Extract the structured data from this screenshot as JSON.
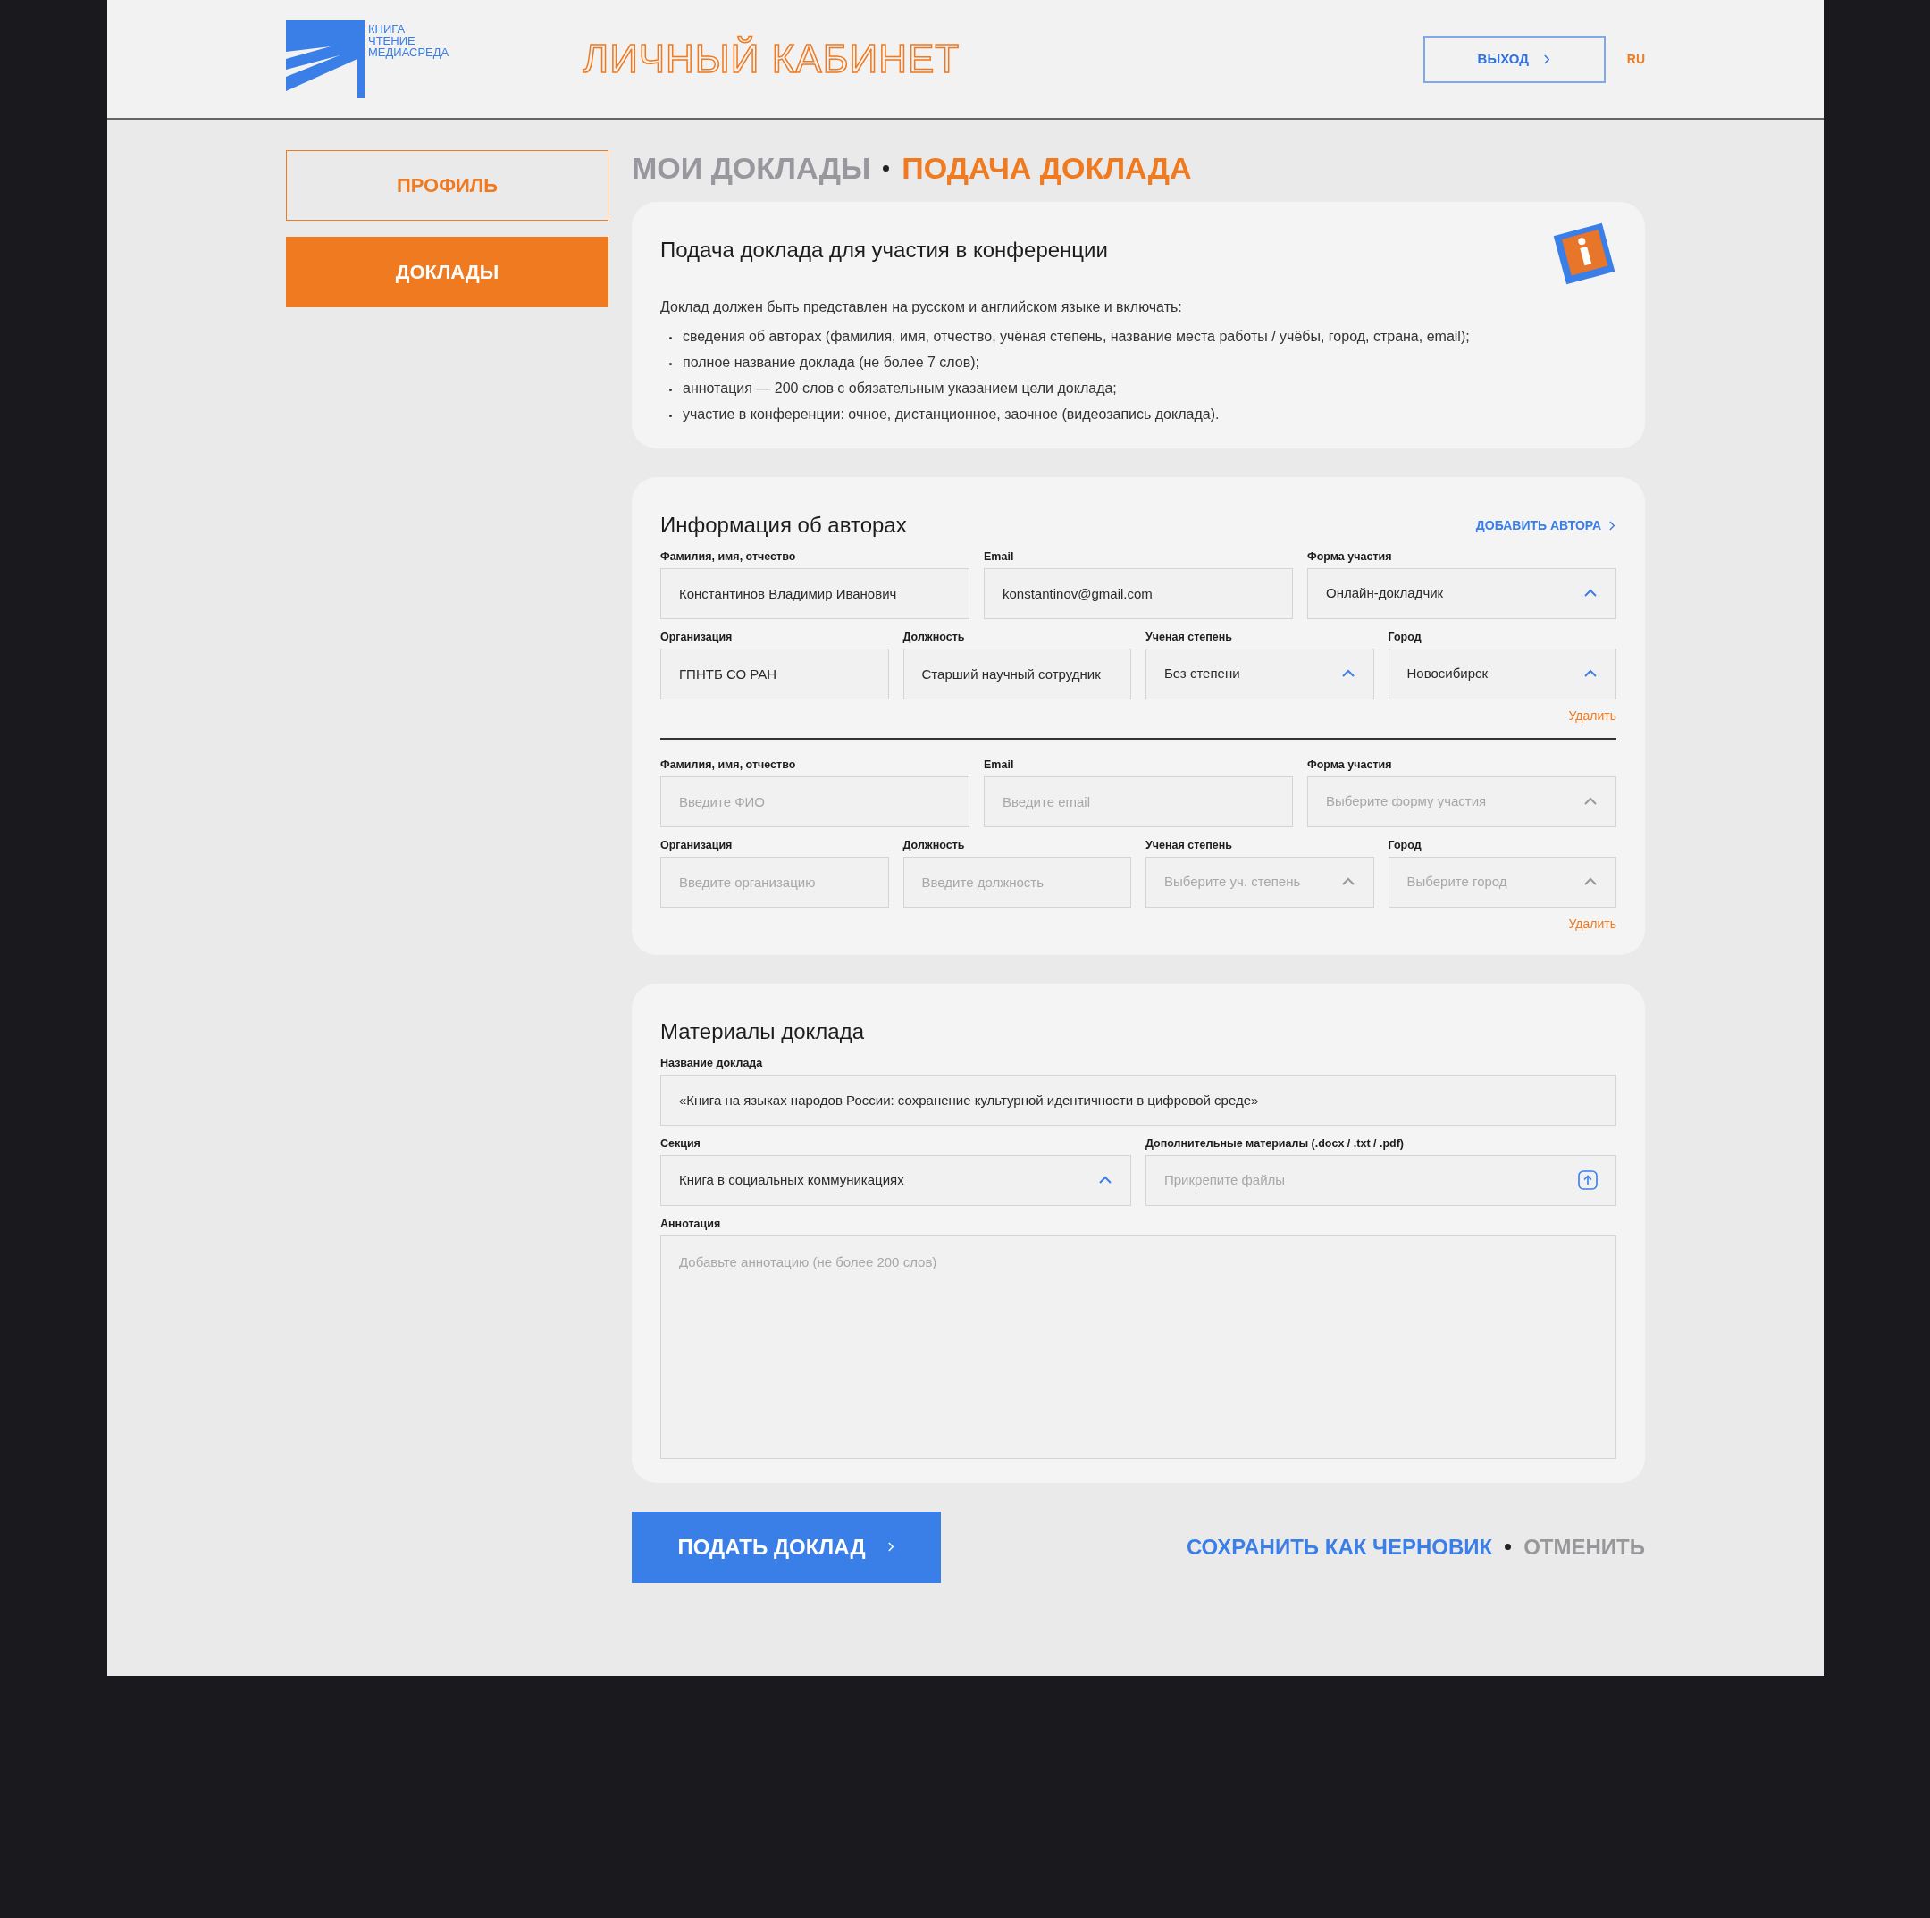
{
  "header": {
    "logo_lines": [
      "КНИГА",
      "ЧТЕНИЕ",
      "МЕДИАСРЕДА"
    ],
    "title": "ЛИЧНЫЙ КАБИНЕТ",
    "logout_button": "ВЫХОД",
    "language": {
      "label": "RU",
      "selected": true
    }
  },
  "sidebar": {
    "items": [
      {
        "label": "ПРОФИЛЬ",
        "selected": false
      },
      {
        "label": "ДОКЛАДЫ",
        "selected": true
      }
    ]
  },
  "breadcrumb": [
    {
      "label": "МОИ ДОКЛАДЫ",
      "selected": false
    },
    {
      "label": "ПОДАЧА ДОКЛАДА",
      "selected": true
    }
  ],
  "info_card": {
    "title": "Подача доклада для участия в конференции",
    "intro": "Доклад должен быть представлен на русском и английском языке и включать:",
    "bullets": [
      "сведения об авторах (фамилия, имя, отчество, учёная степень, название места работы / учёбы, город, страна, email);",
      "полное название доклада (не более 7 слов);",
      "аннотация — 200 слов с обязательным указанием цели доклада;",
      "участие в конференции: очное, дистанционное, заочное (видеозапись доклада)."
    ]
  },
  "authors": {
    "title": "Информация об авторах",
    "add_button": "ДОБАВИТЬ АВТОРА",
    "entries": [
      {
        "rows": [
          {
            "fields": [
              {
                "label": "Фамилия, имя, отчество",
                "kind": "text",
                "value": "Константинов Владимир Иванович"
              },
              {
                "label": "Email",
                "kind": "text",
                "value": "konstantinov@gmail.com"
              },
              {
                "label": "Форма участия",
                "kind": "select",
                "value": "Онлайн-докладчик"
              }
            ]
          },
          {
            "fields": [
              {
                "label": "Организация",
                "kind": "text",
                "value": "ГПНТБ СО РАН"
              },
              {
                "label": "Должность",
                "kind": "text",
                "value": "Старший научный сотрудник"
              },
              {
                "label": "Ученая степень",
                "kind": "select",
                "value": "Без степени"
              },
              {
                "label": "Город",
                "kind": "select",
                "value": "Новосибирск"
              }
            ]
          }
        ],
        "delete": "Удалить"
      },
      {
        "rows": [
          {
            "fields": [
              {
                "label": "Фамилия, имя, отчество",
                "kind": "text",
                "placeholder": "Введите ФИО"
              },
              {
                "label": "Email",
                "kind": "text",
                "placeholder": "Введите email"
              },
              {
                "label": "Форма участия",
                "kind": "select",
                "placeholder": "Выберите форму участия"
              }
            ]
          },
          {
            "fields": [
              {
                "label": "Организация",
                "kind": "text",
                "placeholder": "Введите организацию"
              },
              {
                "label": "Должность",
                "kind": "text",
                "placeholder": "Введите должность"
              },
              {
                "label": "Ученая степень",
                "kind": "select",
                "placeholder": "Выберите уч. степень"
              },
              {
                "label": "Город",
                "kind": "select",
                "placeholder": "Выберите город"
              }
            ]
          }
        ],
        "delete": "Удалить"
      }
    ]
  },
  "materials": {
    "title": "Материалы доклада",
    "rows": [
      {
        "fields": [
          {
            "label": "Название доклада",
            "kind": "text",
            "value": "«Книга на языках народов России: сохранение культурной идентичности в цифровой среде»"
          }
        ]
      },
      {
        "fields": [
          {
            "label": "Секция",
            "kind": "select",
            "value": "Книга в социальных коммуникациях"
          },
          {
            "label": "Дополнительные материалы (.docx / .txt / .pdf)",
            "kind": "file",
            "placeholder": "Прикрепите файлы"
          }
        ]
      },
      {
        "fields": [
          {
            "label": "Аннотация",
            "kind": "textarea",
            "placeholder": "Добавьте аннотацию (не более 200 слов)"
          }
        ]
      }
    ]
  },
  "actions": {
    "submit": "ПОДАТЬ ДОКЛАД",
    "save_draft": "СОХРАНИТЬ КАК ЧЕРНОВИК",
    "cancel": "ОТМЕНИТЬ"
  }
}
